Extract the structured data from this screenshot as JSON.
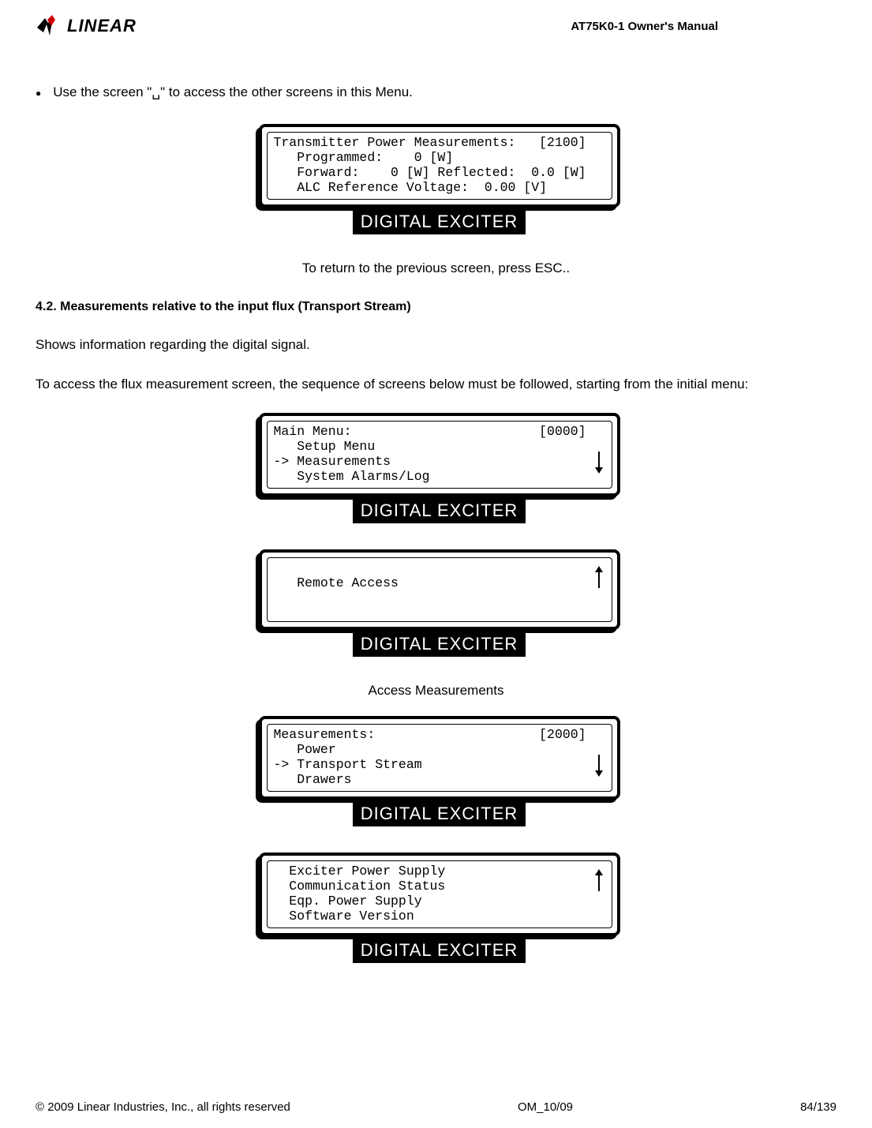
{
  "header": {
    "logo_text": "LINEAR",
    "manual_title": "AT75K0-1 Owner's Manual"
  },
  "intro_bullet": "Use the screen \"␣\" to access the other screens in this Menu.",
  "panel1": {
    "line1": "Transmitter Power Measurements:   [2100]",
    "line2": "   Programmed:    0 [W]",
    "line3": "   Forward:    0 [W] Reflected:  0.0 [W]",
    "line4": "   ALC Reference Voltage:  0.00 [V]",
    "label": "DIGITAL EXCITER"
  },
  "caption1": "To return to the previous screen, press ESC..",
  "section_heading": "4.2. Measurements relative to the input flux (Transport Stream)",
  "body1": "Shows information regarding the digital signal.",
  "body2": "To access the flux measurement screen, the sequence of screens below must be followed, starting from the initial menu:",
  "panel2": {
    "line1": "Main Menu:                        [0000]",
    "line2": "   Setup Menu",
    "line3": "-> Measurements",
    "line4": "   System Alarms/Log",
    "label": "DIGITAL EXCITER"
  },
  "panel3": {
    "line1": "",
    "line2": "   Remote Access",
    "line3": "",
    "line4": "",
    "label": "DIGITAL EXCITER"
  },
  "intermediate": "Access Measurements",
  "panel4": {
    "line1": "Measurements:                     [2000]",
    "line2": "   Power",
    "line3": "-> Transport Stream",
    "line4": "   Drawers",
    "label": "DIGITAL EXCITER"
  },
  "panel5": {
    "line1": "  Exciter Power Supply",
    "line2": "  Communication Status",
    "line3": "  Eqp. Power Supply",
    "line4": "  Software Version",
    "label": "DIGITAL EXCITER"
  },
  "footer": {
    "copyright": "© 2009 Linear Industries, Inc., all rights reserved",
    "doc_id": "OM_10/09",
    "page": "84/139"
  }
}
